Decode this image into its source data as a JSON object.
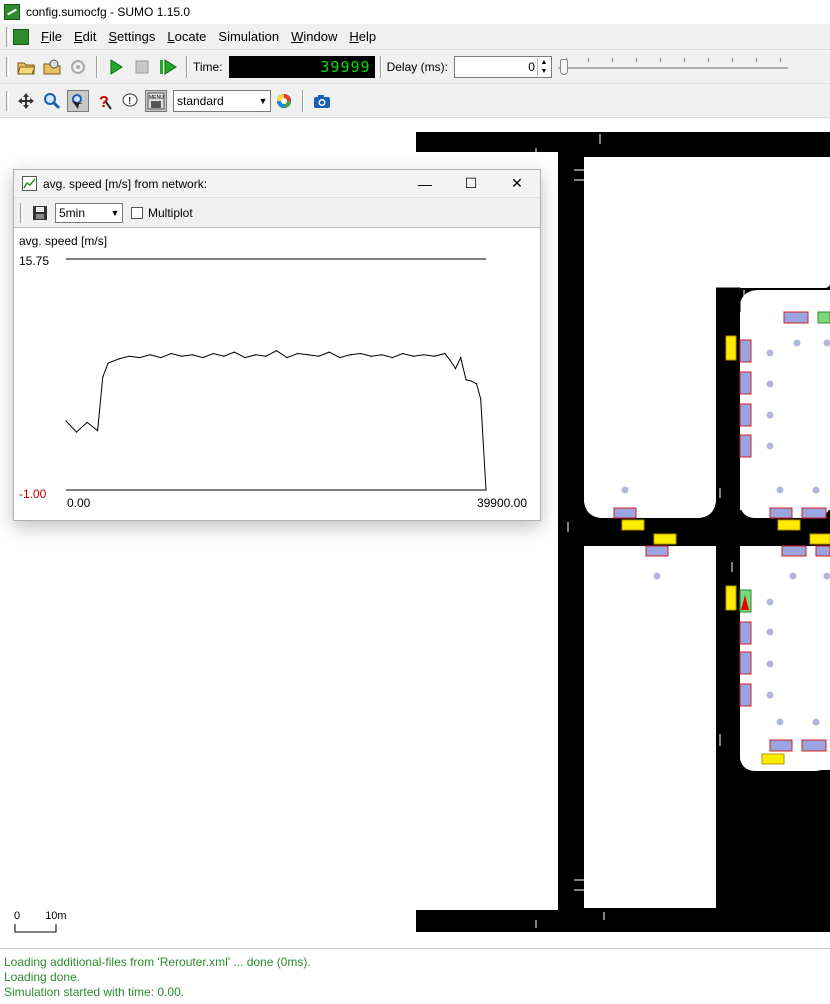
{
  "window": {
    "title": "config.sumocfg - SUMO 1.15.0",
    "app_icon": "sumo-icon"
  },
  "menu": {
    "items": [
      {
        "label_u": "F",
        "label_rest": "ile"
      },
      {
        "label_u": "E",
        "label_rest": "dit"
      },
      {
        "label_u": "S",
        "label_rest": "ettings"
      },
      {
        "label_u": "L",
        "label_rest": "ocate"
      },
      {
        "label_u": "",
        "label_rest": "Simulation"
      },
      {
        "label_u": "W",
        "label_rest": "indow"
      },
      {
        "label_u": "H",
        "label_rest": "elp"
      }
    ]
  },
  "toolbar": {
    "time_label": "Time:",
    "time_value": "39999",
    "delay_label": "Delay (ms):",
    "delay_value": "0"
  },
  "view_toolbar": {
    "scheme": "standard"
  },
  "canvas": {
    "scale_zero": "0",
    "scale_label": "10m"
  },
  "plot_window": {
    "title": "avg. speed [m/s] from network:",
    "interval": "5min",
    "multiplot_label": "Multiplot",
    "multiplot_checked": false
  },
  "chart_data": {
    "type": "line",
    "title": "avg. speed [m/s]",
    "ymax_label": "15.75",
    "ymin_label": "-1.00",
    "xmin_label": "0.00",
    "xmax_label": "39900.00",
    "xlim": [
      0,
      39900
    ],
    "ylim": [
      -1.0,
      15.75
    ],
    "series": [
      {
        "x": [
          0,
          1000,
          2000,
          3000,
          3500,
          4000,
          5000,
          6000,
          7000,
          8000,
          9000,
          10000,
          11000,
          12000,
          13000,
          14000,
          15000,
          16000,
          17000,
          18000,
          19000,
          20000,
          21000,
          22000,
          23000,
          24000,
          25000,
          26000,
          27000,
          28000,
          29000,
          30000,
          31000,
          32000,
          33000,
          34000,
          35000,
          36000,
          36500,
          37000,
          37500,
          38000,
          38500,
          39000,
          39400,
          39900
        ],
        "y": [
          4.0,
          3.2,
          3.9,
          3.3,
          7.2,
          8.2,
          8.5,
          8.7,
          8.6,
          8.8,
          8.6,
          8.9,
          8.7,
          8.8,
          8.6,
          8.9,
          8.7,
          9.0,
          8.6,
          8.8,
          8.7,
          9.1,
          8.6,
          8.9,
          8.8,
          8.7,
          9.0,
          8.6,
          8.8,
          8.9,
          8.7,
          8.8,
          8.6,
          8.9,
          8.7,
          8.8,
          8.7,
          8.9,
          8.4,
          7.8,
          8.6,
          7.0,
          6.9,
          6.7,
          5.6,
          -1.0
        ]
      }
    ]
  },
  "log": [
    "Loading additional-files from 'Rerouter.xml' ... done (0ms).",
    "Loading done.",
    "Simulation started with time: 0.00."
  ]
}
